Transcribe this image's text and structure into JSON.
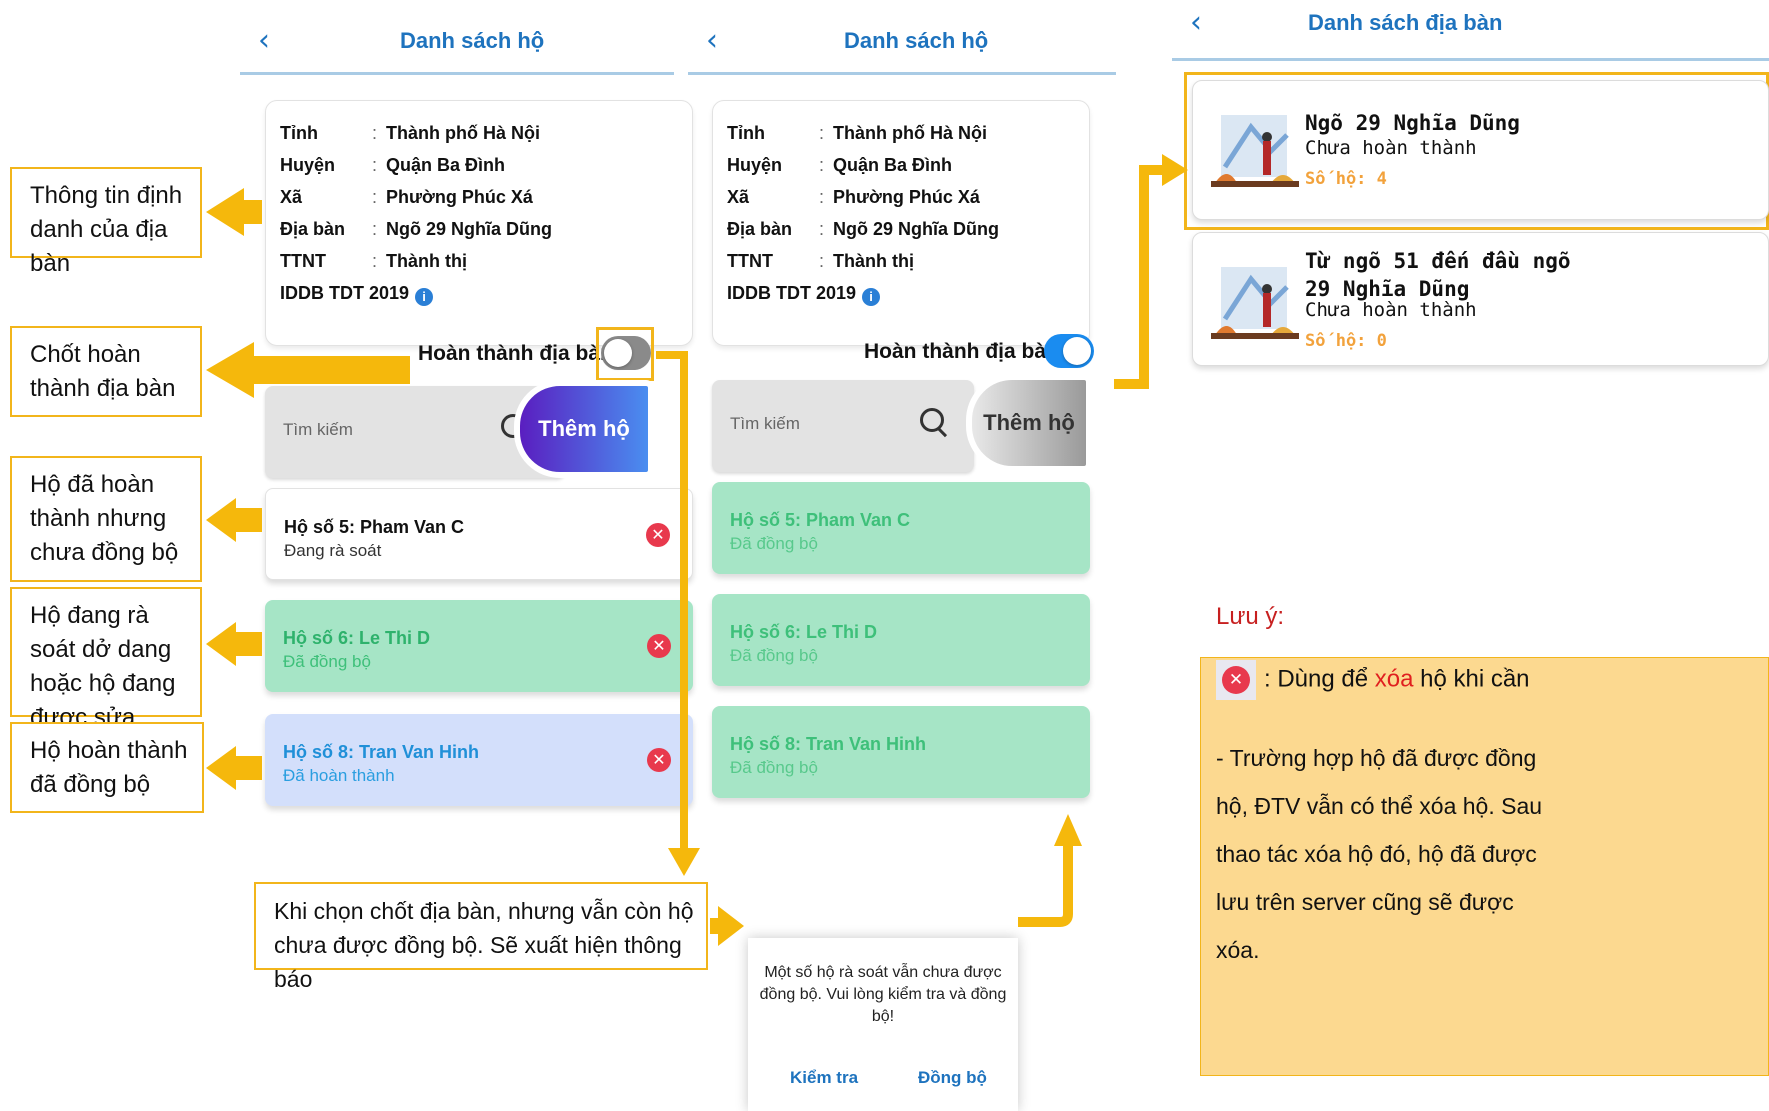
{
  "screen1": {
    "title": "Danh sách hộ",
    "back_icon": "chevron-left-icon",
    "info": {
      "rows": [
        {
          "key": "Tỉnh",
          "value": "Thành phố Hà Nội"
        },
        {
          "key": "Huyện",
          "value": "Quận Ba Đình"
        },
        {
          "key": "Xã",
          "value": "Phường Phúc Xá"
        },
        {
          "key": "Địa bàn",
          "value": "Ngõ 29 Nghĩa Dũng"
        },
        {
          "key": "TTNT",
          "value": "Thành thị"
        }
      ],
      "separator": ":",
      "iddb": "IDDB TDT 2019",
      "iddb_icon": "info-icon"
    },
    "toggle_label": "Hoàn thành địa bàn",
    "toggle_on": false,
    "search_placeholder": "Tìm kiếm",
    "add_button": "Thêm hộ",
    "households": [
      {
        "name": "Hộ số 5: Pham Van C",
        "status": "Đang rà soát",
        "style": "white"
      },
      {
        "name": "Hộ số 6: Le Thi D",
        "status": "Đã đồng bộ",
        "style": "green"
      },
      {
        "name": "Hộ số 8: Tran Van Hinh",
        "status": "Đã hoàn thành",
        "style": "blue"
      }
    ],
    "delete_icon": "✕"
  },
  "screen2": {
    "title": "Danh sách hộ",
    "info": {
      "rows": [
        {
          "key": "Tỉnh",
          "value": "Thành phố Hà Nội"
        },
        {
          "key": "Huyện",
          "value": "Quận Ba Đình"
        },
        {
          "key": "Xã",
          "value": "Phường Phúc Xá"
        },
        {
          "key": "Địa bàn",
          "value": "Ngõ 29 Nghĩa Dũng"
        },
        {
          "key": "TTNT",
          "value": "Thành thị"
        }
      ],
      "iddb": "IDDB TDT 2019"
    },
    "toggle_label": "Hoàn thành địa bàn",
    "toggle_on": true,
    "search_placeholder": "Tìm kiếm",
    "add_button": "Thêm hộ",
    "households": [
      {
        "name": "Hộ số 5: Pham Van C",
        "status": "Đã đồng bộ"
      },
      {
        "name": "Hộ số 6: Le Thi D",
        "status": "Đã đồng bộ"
      },
      {
        "name": "Hộ số 8: Tran Van Hinh",
        "status": "Đã đồng bộ"
      }
    ],
    "dialog": {
      "message": "Một số hộ rà soát vẫn chưa được đồng bộ. Vui lòng kiểm tra và đồng bộ!",
      "check_button": "Kiểm tra",
      "sync_button": "Đồng bộ"
    }
  },
  "screen3": {
    "title": "Danh sách địa bàn",
    "locations": [
      {
        "title": "Ngõ 29 Nghĩa Dũng",
        "status": "Chưa hoàn thành",
        "count": "Số hộ: 4"
      },
      {
        "title": "Từ ngõ 51 đến đầu ngõ 29 Nghĩa Dũng",
        "status": "Chưa hoàn thành",
        "count": "Số hộ: 0"
      }
    ]
  },
  "annotations": {
    "a1": "Thông tin định danh của địa bàn",
    "a2": "Chốt hoàn thành địa bàn",
    "a3": "Hộ đã hoàn thành nhưng chưa đồng bộ",
    "a4": "Hộ đang rà soát dở dang hoặc hộ đang được sửa",
    "a5": "Hộ hoàn thành đã đồng bộ",
    "a6": "Khi chọn chốt địa bàn, nhưng vẫn còn hộ chưa được đồng bộ. Sẽ xuất hiện thông báo"
  },
  "note": {
    "heading": "Lưu ý:",
    "delete_line_pre": ": Dùng để ",
    "delete_word": "xóa",
    "delete_line_post": " hộ khi cần",
    "paragraph": "- Trường hợp hộ đã được đồng hộ, ĐTV vẫn có thể xóa hộ. Sau thao tác xóa hộ đó, hộ đã được lưu trên server cũng sẽ được xóa."
  },
  "colors": {
    "accent_blue": "#1e73be",
    "annotation_yellow": "#f2b51b",
    "green_card": "#a6e5c6",
    "blue_card": "#d3dffb",
    "delete_red": "#e8394d",
    "toggle_on": "#1a8cf0",
    "toggle_off": "#8a8a8a"
  }
}
